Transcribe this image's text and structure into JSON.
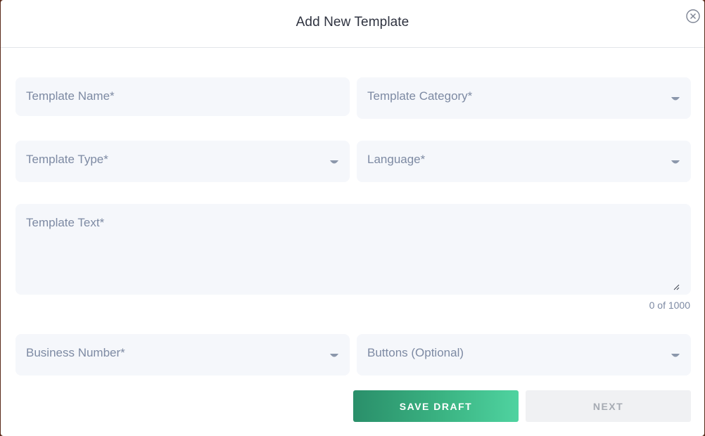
{
  "modal": {
    "title": "Add New Template",
    "close_icon": "close-circle-icon"
  },
  "form": {
    "template_name": {
      "placeholder": "Template Name*"
    },
    "template_category": {
      "placeholder": "Template Category*",
      "icon": "caret-down-icon"
    },
    "template_type": {
      "placeholder": "Template Type*",
      "icon": "caret-down-icon"
    },
    "language": {
      "placeholder": "Language*",
      "icon": "caret-down-icon"
    },
    "template_text": {
      "placeholder": "Template Text*",
      "counter": "0 of 1000"
    },
    "business_number": {
      "placeholder": "Business Number*",
      "icon": "caret-down-icon"
    },
    "buttons": {
      "placeholder": "Buttons (Optional)",
      "icon": "caret-down-icon"
    }
  },
  "actions": {
    "save_draft_label": "SAVE DRAFT",
    "next_label": "NEXT",
    "next_disabled": true
  },
  "colors": {
    "accent_start": "#2a8f6a",
    "accent_end": "#4fd3a0",
    "field_bg": "#f5f7fb",
    "placeholder_text": "#7d8aa3",
    "title_text": "#2f3340"
  }
}
